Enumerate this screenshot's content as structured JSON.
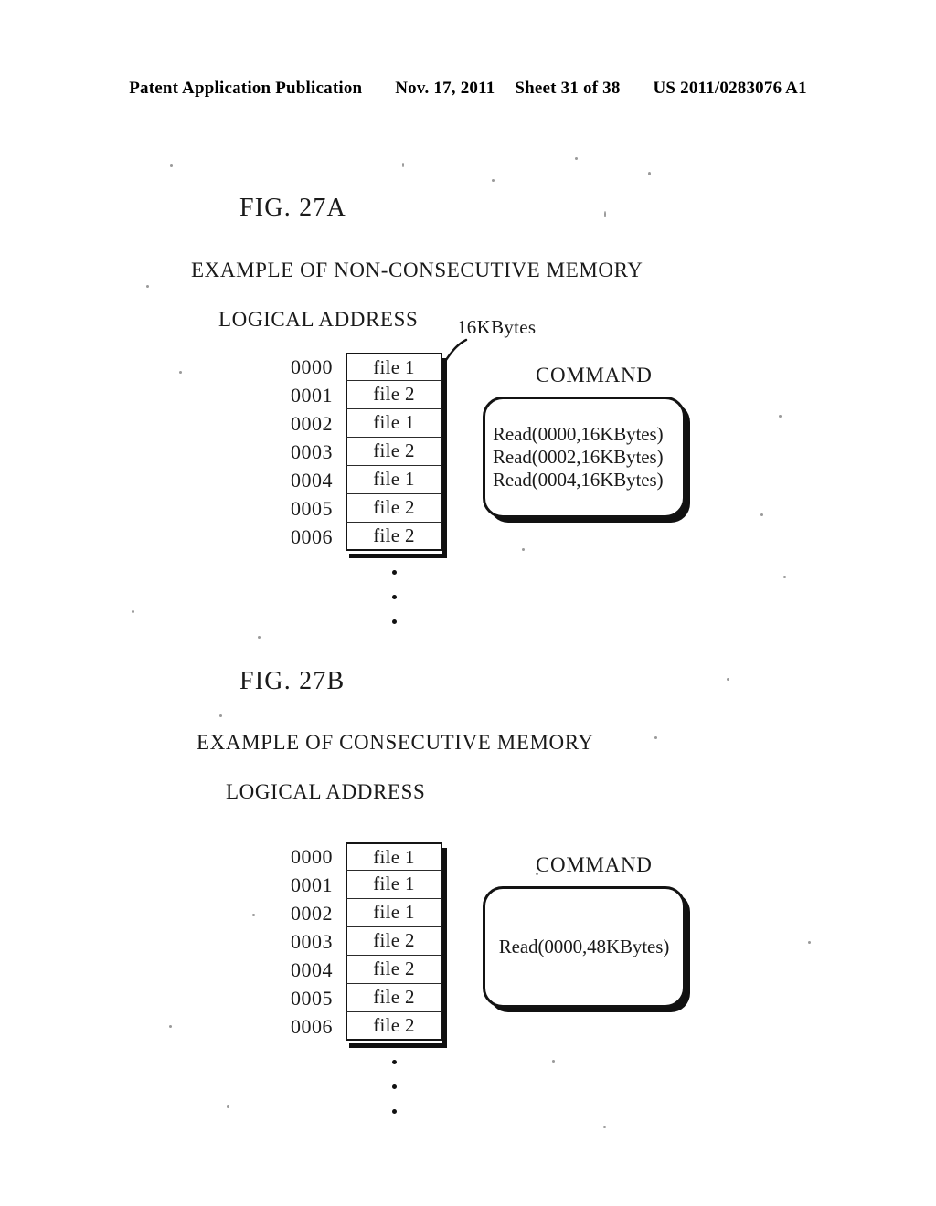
{
  "header": {
    "publication": "Patent Application Publication",
    "date": "Nov. 17, 2011",
    "sheet": "Sheet 31 of 38",
    "patent_number": "US 2011/0283076 A1"
  },
  "figures": [
    {
      "id": "27A",
      "title": "FIG. 27A",
      "subtitle": "EXAMPLE OF NON-CONSECUTIVE MEMORY",
      "address_heading": "LOGICAL ADDRESS",
      "size_callout": "16KBytes",
      "command_title": "COMMAND",
      "commands": [
        "Read(0000,16KBytes)",
        "Read(0002,16KBytes)",
        "Read(0004,16KBytes)"
      ],
      "rows": [
        {
          "address": "0000",
          "content": "file 1"
        },
        {
          "address": "0001",
          "content": "file 2"
        },
        {
          "address": "0002",
          "content": "file 1"
        },
        {
          "address": "0003",
          "content": "file 2"
        },
        {
          "address": "0004",
          "content": "file 1"
        },
        {
          "address": "0005",
          "content": "file 2"
        },
        {
          "address": "0006",
          "content": "file 2"
        }
      ]
    },
    {
      "id": "27B",
      "title": "FIG. 27B",
      "subtitle": "EXAMPLE OF CONSECUTIVE MEMORY",
      "address_heading": "LOGICAL ADDRESS",
      "command_title": "COMMAND",
      "commands": [
        "Read(0000,48KBytes)"
      ],
      "rows": [
        {
          "address": "0000",
          "content": "file 1"
        },
        {
          "address": "0001",
          "content": "file 1"
        },
        {
          "address": "0002",
          "content": "file 1"
        },
        {
          "address": "0003",
          "content": "file 2"
        },
        {
          "address": "0004",
          "content": "file 2"
        },
        {
          "address": "0005",
          "content": "file 2"
        },
        {
          "address": "0006",
          "content": "file 2"
        }
      ]
    }
  ],
  "colors": {
    "ink": "#1a1a1a",
    "rule": "#151515",
    "page": "#ffffff"
  }
}
